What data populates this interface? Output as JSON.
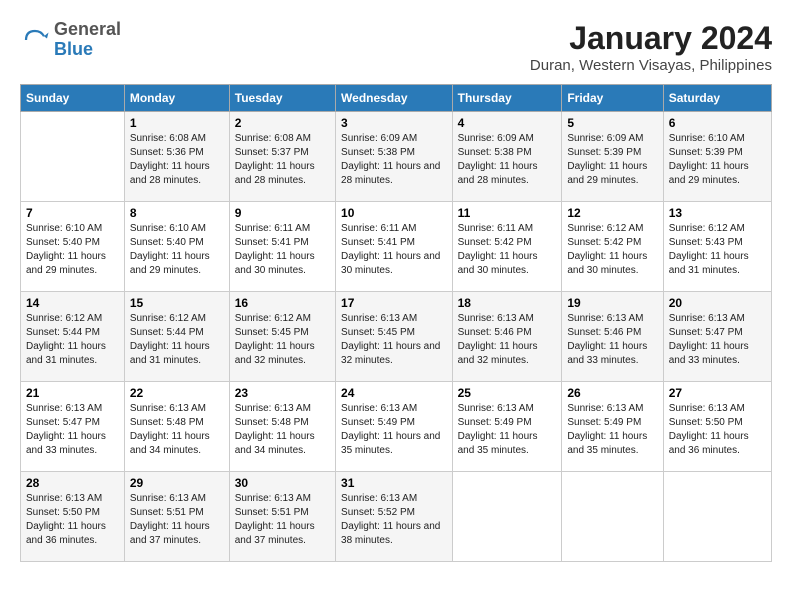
{
  "header": {
    "logo_general": "General",
    "logo_blue": "Blue",
    "main_title": "January 2024",
    "subtitle": "Duran, Western Visayas, Philippines"
  },
  "days_of_week": [
    "Sunday",
    "Monday",
    "Tuesday",
    "Wednesday",
    "Thursday",
    "Friday",
    "Saturday"
  ],
  "weeks": [
    [
      null,
      {
        "day": 1,
        "sunrise": "6:08 AM",
        "sunset": "5:36 PM",
        "daylight": "11 hours and 28 minutes."
      },
      {
        "day": 2,
        "sunrise": "6:08 AM",
        "sunset": "5:37 PM",
        "daylight": "11 hours and 28 minutes."
      },
      {
        "day": 3,
        "sunrise": "6:09 AM",
        "sunset": "5:38 PM",
        "daylight": "11 hours and 28 minutes."
      },
      {
        "day": 4,
        "sunrise": "6:09 AM",
        "sunset": "5:38 PM",
        "daylight": "11 hours and 28 minutes."
      },
      {
        "day": 5,
        "sunrise": "6:09 AM",
        "sunset": "5:39 PM",
        "daylight": "11 hours and 29 minutes."
      },
      {
        "day": 6,
        "sunrise": "6:10 AM",
        "sunset": "5:39 PM",
        "daylight": "11 hours and 29 minutes."
      }
    ],
    [
      {
        "day": 7,
        "sunrise": "6:10 AM",
        "sunset": "5:40 PM",
        "daylight": "11 hours and 29 minutes."
      },
      {
        "day": 8,
        "sunrise": "6:10 AM",
        "sunset": "5:40 PM",
        "daylight": "11 hours and 29 minutes."
      },
      {
        "day": 9,
        "sunrise": "6:11 AM",
        "sunset": "5:41 PM",
        "daylight": "11 hours and 30 minutes."
      },
      {
        "day": 10,
        "sunrise": "6:11 AM",
        "sunset": "5:41 PM",
        "daylight": "11 hours and 30 minutes."
      },
      {
        "day": 11,
        "sunrise": "6:11 AM",
        "sunset": "5:42 PM",
        "daylight": "11 hours and 30 minutes."
      },
      {
        "day": 12,
        "sunrise": "6:12 AM",
        "sunset": "5:42 PM",
        "daylight": "11 hours and 30 minutes."
      },
      {
        "day": 13,
        "sunrise": "6:12 AM",
        "sunset": "5:43 PM",
        "daylight": "11 hours and 31 minutes."
      }
    ],
    [
      {
        "day": 14,
        "sunrise": "6:12 AM",
        "sunset": "5:44 PM",
        "daylight": "11 hours and 31 minutes."
      },
      {
        "day": 15,
        "sunrise": "6:12 AM",
        "sunset": "5:44 PM",
        "daylight": "11 hours and 31 minutes."
      },
      {
        "day": 16,
        "sunrise": "6:12 AM",
        "sunset": "5:45 PM",
        "daylight": "11 hours and 32 minutes."
      },
      {
        "day": 17,
        "sunrise": "6:13 AM",
        "sunset": "5:45 PM",
        "daylight": "11 hours and 32 minutes."
      },
      {
        "day": 18,
        "sunrise": "6:13 AM",
        "sunset": "5:46 PM",
        "daylight": "11 hours and 32 minutes."
      },
      {
        "day": 19,
        "sunrise": "6:13 AM",
        "sunset": "5:46 PM",
        "daylight": "11 hours and 33 minutes."
      },
      {
        "day": 20,
        "sunrise": "6:13 AM",
        "sunset": "5:47 PM",
        "daylight": "11 hours and 33 minutes."
      }
    ],
    [
      {
        "day": 21,
        "sunrise": "6:13 AM",
        "sunset": "5:47 PM",
        "daylight": "11 hours and 33 minutes."
      },
      {
        "day": 22,
        "sunrise": "6:13 AM",
        "sunset": "5:48 PM",
        "daylight": "11 hours and 34 minutes."
      },
      {
        "day": 23,
        "sunrise": "6:13 AM",
        "sunset": "5:48 PM",
        "daylight": "11 hours and 34 minutes."
      },
      {
        "day": 24,
        "sunrise": "6:13 AM",
        "sunset": "5:49 PM",
        "daylight": "11 hours and 35 minutes."
      },
      {
        "day": 25,
        "sunrise": "6:13 AM",
        "sunset": "5:49 PM",
        "daylight": "11 hours and 35 minutes."
      },
      {
        "day": 26,
        "sunrise": "6:13 AM",
        "sunset": "5:49 PM",
        "daylight": "11 hours and 35 minutes."
      },
      {
        "day": 27,
        "sunrise": "6:13 AM",
        "sunset": "5:50 PM",
        "daylight": "11 hours and 36 minutes."
      }
    ],
    [
      {
        "day": 28,
        "sunrise": "6:13 AM",
        "sunset": "5:50 PM",
        "daylight": "11 hours and 36 minutes."
      },
      {
        "day": 29,
        "sunrise": "6:13 AM",
        "sunset": "5:51 PM",
        "daylight": "11 hours and 37 minutes."
      },
      {
        "day": 30,
        "sunrise": "6:13 AM",
        "sunset": "5:51 PM",
        "daylight": "11 hours and 37 minutes."
      },
      {
        "day": 31,
        "sunrise": "6:13 AM",
        "sunset": "5:52 PM",
        "daylight": "11 hours and 38 minutes."
      },
      null,
      null,
      null
    ]
  ]
}
